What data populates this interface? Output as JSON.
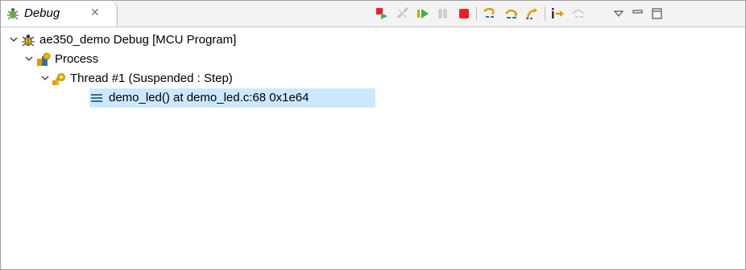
{
  "tab": {
    "title": "Debug",
    "icon": "debug-bug-icon",
    "close_icon": "close-icon"
  },
  "toolbar": {
    "items": [
      "skip-all-breakpoints-icon",
      "disconnect-icon",
      "resume-icon",
      "suspend-icon",
      "terminate-icon",
      "step-into-icon",
      "step-over-icon",
      "step-return-icon",
      "instruction-stepping-icon",
      "use-step-filters-icon",
      "view-menu-icon",
      "minimize-icon",
      "maximize-icon"
    ]
  },
  "tree": {
    "launch": {
      "label": "ae350_demo Debug [MCU Program]",
      "icon": "launch-bug-icon"
    },
    "process": {
      "label": "Process",
      "icon": "process-icon"
    },
    "thread": {
      "label": "Thread #1 (Suspended : Step)",
      "icon": "thread-icon"
    },
    "frame": {
      "label": "demo_led() at demo_led.c:68 0x1e64",
      "icon": "stack-frame-icon"
    }
  },
  "colors": {
    "selection": "#cce8ff",
    "terminate": "#e8202a",
    "resume": "#3bb44a",
    "step": "#d8a000"
  }
}
